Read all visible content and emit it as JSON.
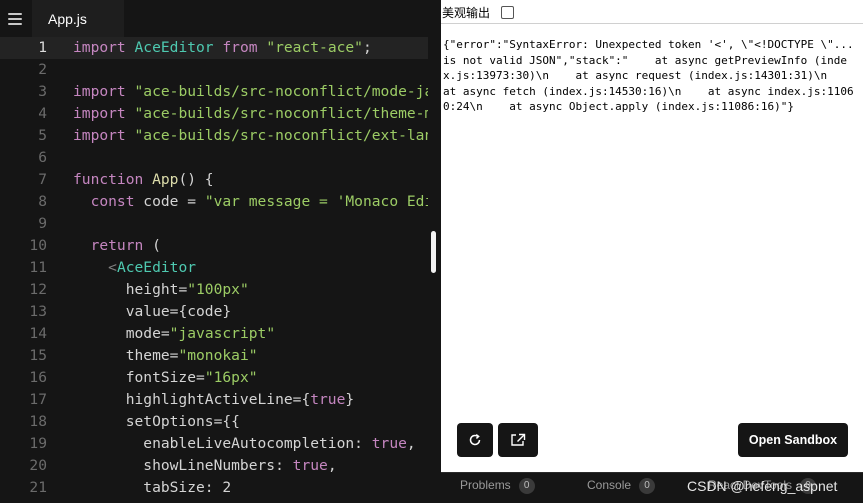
{
  "editor": {
    "file_tab": "App.js",
    "lines": [
      {
        "n": "1",
        "tokens": [
          [
            "kw",
            "import "
          ],
          [
            "cmp",
            "AceEditor"
          ],
          [
            "kw",
            " from "
          ],
          [
            "str",
            "\"react-ace\""
          ],
          [
            "pun",
            ";"
          ]
        ]
      },
      {
        "n": "2",
        "tokens": []
      },
      {
        "n": "3",
        "tokens": [
          [
            "kw",
            "import "
          ],
          [
            "str",
            "\"ace-builds/src-noconflict/mode-javascript\""
          ],
          [
            "pun",
            ";"
          ]
        ]
      },
      {
        "n": "4",
        "tokens": [
          [
            "kw",
            "import "
          ],
          [
            "str",
            "\"ace-builds/src-noconflict/theme-monokai\""
          ],
          [
            "pun",
            ";"
          ]
        ]
      },
      {
        "n": "5",
        "tokens": [
          [
            "kw",
            "import "
          ],
          [
            "str",
            "\"ace-builds/src-noconflict/ext-language_tools\""
          ],
          [
            "pun",
            ";"
          ]
        ]
      },
      {
        "n": "6",
        "tokens": []
      },
      {
        "n": "7",
        "tokens": [
          [
            "kw",
            "function "
          ],
          [
            "fn",
            "App"
          ],
          [
            "pun",
            "() {"
          ]
        ]
      },
      {
        "n": "8",
        "tokens": [
          [
            "pun",
            "  "
          ],
          [
            "kw",
            "const "
          ],
          [
            "attr",
            "code"
          ],
          [
            "pun",
            " = "
          ],
          [
            "str",
            "\"var message = 'Monaco Editor';\""
          ],
          [
            "pun",
            ";"
          ]
        ]
      },
      {
        "n": "9",
        "tokens": []
      },
      {
        "n": "10",
        "tokens": [
          [
            "pun",
            "  "
          ],
          [
            "kw",
            "return "
          ],
          [
            "pun",
            "("
          ]
        ]
      },
      {
        "n": "11",
        "tokens": [
          [
            "pun",
            "    "
          ],
          [
            "tag",
            "<"
          ],
          [
            "cmp",
            "AceEditor"
          ]
        ]
      },
      {
        "n": "12",
        "tokens": [
          [
            "attr",
            "      height"
          ],
          [
            "pun",
            "="
          ],
          [
            "str",
            "\"100px\""
          ]
        ]
      },
      {
        "n": "13",
        "tokens": [
          [
            "attr",
            "      value"
          ],
          [
            "pun",
            "={code}"
          ]
        ]
      },
      {
        "n": "14",
        "tokens": [
          [
            "attr",
            "      mode"
          ],
          [
            "pun",
            "="
          ],
          [
            "str",
            "\"javascript\""
          ]
        ]
      },
      {
        "n": "15",
        "tokens": [
          [
            "attr",
            "      theme"
          ],
          [
            "pun",
            "="
          ],
          [
            "str",
            "\"monokai\""
          ]
        ]
      },
      {
        "n": "16",
        "tokens": [
          [
            "attr",
            "      fontSize"
          ],
          [
            "pun",
            "="
          ],
          [
            "str",
            "\"16px\""
          ]
        ]
      },
      {
        "n": "17",
        "tokens": [
          [
            "attr",
            "      highlightActiveLine"
          ],
          [
            "pun",
            "={"
          ],
          [
            "bool",
            "true"
          ],
          [
            "pun",
            "}"
          ]
        ]
      },
      {
        "n": "18",
        "tokens": [
          [
            "attr",
            "      setOptions"
          ],
          [
            "pun",
            "={{"
          ]
        ]
      },
      {
        "n": "19",
        "tokens": [
          [
            "attr",
            "        enableLiveAutocompletion"
          ],
          [
            "pun",
            ": "
          ],
          [
            "bool",
            "true"
          ],
          [
            "pun",
            ","
          ]
        ]
      },
      {
        "n": "20",
        "tokens": [
          [
            "attr",
            "        showLineNumbers"
          ],
          [
            "pun",
            ": "
          ],
          [
            "bool",
            "true"
          ],
          [
            "pun",
            ","
          ]
        ]
      },
      {
        "n": "21",
        "tokens": [
          [
            "attr",
            "        tabSize"
          ],
          [
            "pun",
            ": "
          ],
          [
            "num",
            "2"
          ]
        ]
      }
    ]
  },
  "preview": {
    "toolbar_label": "美观输出",
    "output_text": "{\"error\":\"SyntaxError: Unexpected token '<', \\\"<!DOCTYPE \\\"... is not valid JSON\",\"stack\":\"    at async getPreviewInfo (index.js:13973:30)\\n    at async request (index.js:14301:31)\\n    at async fetch (index.js:14530:16)\\n    at async index.js:11060:24\\n    at async Object.apply (index.js:11086:16)\"}",
    "open_sandbox_label": "Open Sandbox"
  },
  "bottom_tabs": [
    {
      "label": "Problems",
      "count": "0"
    },
    {
      "label": "Console",
      "count": "0"
    },
    {
      "label": "React DevTools",
      "count": "0"
    }
  ],
  "watermark": "CSDN @hefeng_aspnet",
  "icons": {
    "menu": "hamburger-menu-icon",
    "refresh": "refresh-icon",
    "open_external": "open-in-new-window-icon"
  }
}
